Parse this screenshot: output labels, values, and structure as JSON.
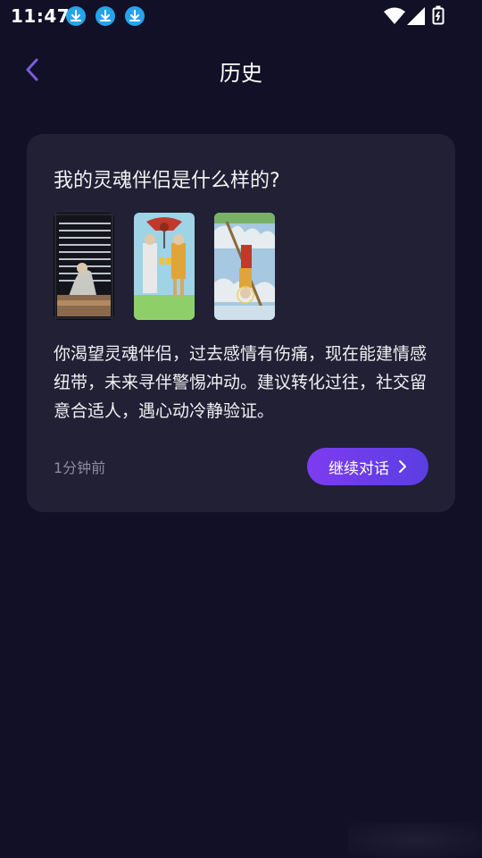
{
  "status_bar": {
    "time": "11:47",
    "icons": [
      "download-icon",
      "download-icon",
      "download-icon",
      "wifi-icon",
      "signal-icon",
      "battery-icon"
    ]
  },
  "header": {
    "back_icon": "chevron-left-icon",
    "title": "历史"
  },
  "history_item": {
    "question": "我的灵魂伴侣是什么样的?",
    "cards": [
      {
        "name": "Nine of Swords",
        "orientation": "upright"
      },
      {
        "name": "Two of Cups",
        "orientation": "upright"
      },
      {
        "name": "The Hanged Man",
        "orientation": "reversed"
      }
    ],
    "interpretation": "你渴望灵魂伴侣，过去感情有伤痛，现在能建情感纽带，未来寻伴警惕冲动。建议转化过往，社交留意合适人，遇心动冷静验证。",
    "time_ago": "1分钟前",
    "continue_label": "继续对话"
  },
  "colors": {
    "background": "#121026",
    "card": "#212034",
    "accent_start": "#7d3cf0",
    "accent_end": "#5a3ee2",
    "download_badge": "#27a3ea"
  }
}
